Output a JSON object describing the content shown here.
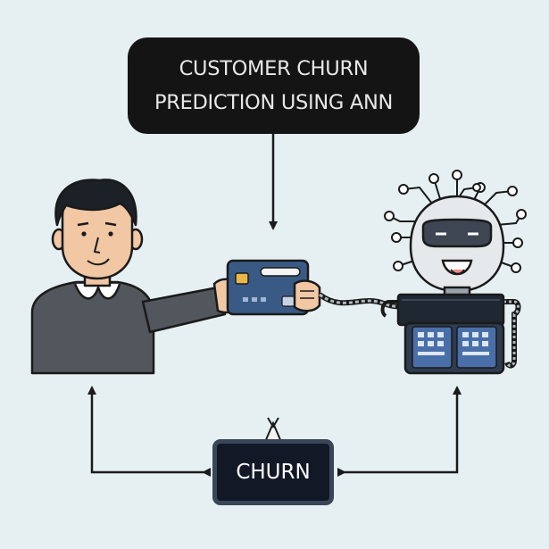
{
  "title": {
    "line1": "CUSTOMER CHURN",
    "line2": "PREDICTION USING ANN"
  },
  "churn_label": "CHURN",
  "icons": [
    "customer-person-icon",
    "credit-card-icon",
    "robot-ann-icon"
  ],
  "colors": {
    "background": "#e6f0f3",
    "title_box": "#141414",
    "churn_box": "#121826",
    "card": "#3a5a86",
    "robot_body": "#2d3c50"
  }
}
